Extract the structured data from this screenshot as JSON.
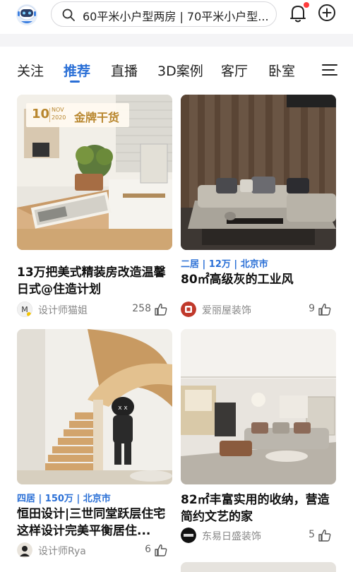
{
  "header": {
    "search_query": "60平米小户型两房 | 70平米小户型...",
    "notification_badge": true
  },
  "tabs": [
    {
      "label": "关注",
      "active": false
    },
    {
      "label": "推荐",
      "active": true
    },
    {
      "label": "直播",
      "active": false
    },
    {
      "label": "3D案例",
      "active": false
    },
    {
      "label": "客厅",
      "active": false
    },
    {
      "label": "卧室",
      "active": false
    }
  ],
  "cards": [
    {
      "badge": {
        "day": "10",
        "month": "NOV",
        "year": "2020",
        "text": "金牌干货"
      },
      "tagline": "",
      "title": "13万把美式精装房改造温馨日式@住造计划",
      "author": "设计师猫姐",
      "likes": "258"
    },
    {
      "tagline": "二居 | 12万 | 北京市",
      "title": "80㎡高级灰的工业风",
      "author": "爱丽屋装饰",
      "likes": "9"
    },
    {
      "tagline": "四居 | 150万 | 北京市",
      "title": "恒田设计|三世同堂跃层住宅 这样设计完美平衡居住...",
      "author": "设计师Rya",
      "likes": "6"
    },
    {
      "tagline": "",
      "title": "82㎡丰富实用的收纳，营造简约文艺的家",
      "author": "东易日盛装饰",
      "likes": "5"
    }
  ],
  "colors": {
    "accent": "#2a6fd6",
    "badge_gold": "#b8862d",
    "notification": "#ff3b3b"
  }
}
